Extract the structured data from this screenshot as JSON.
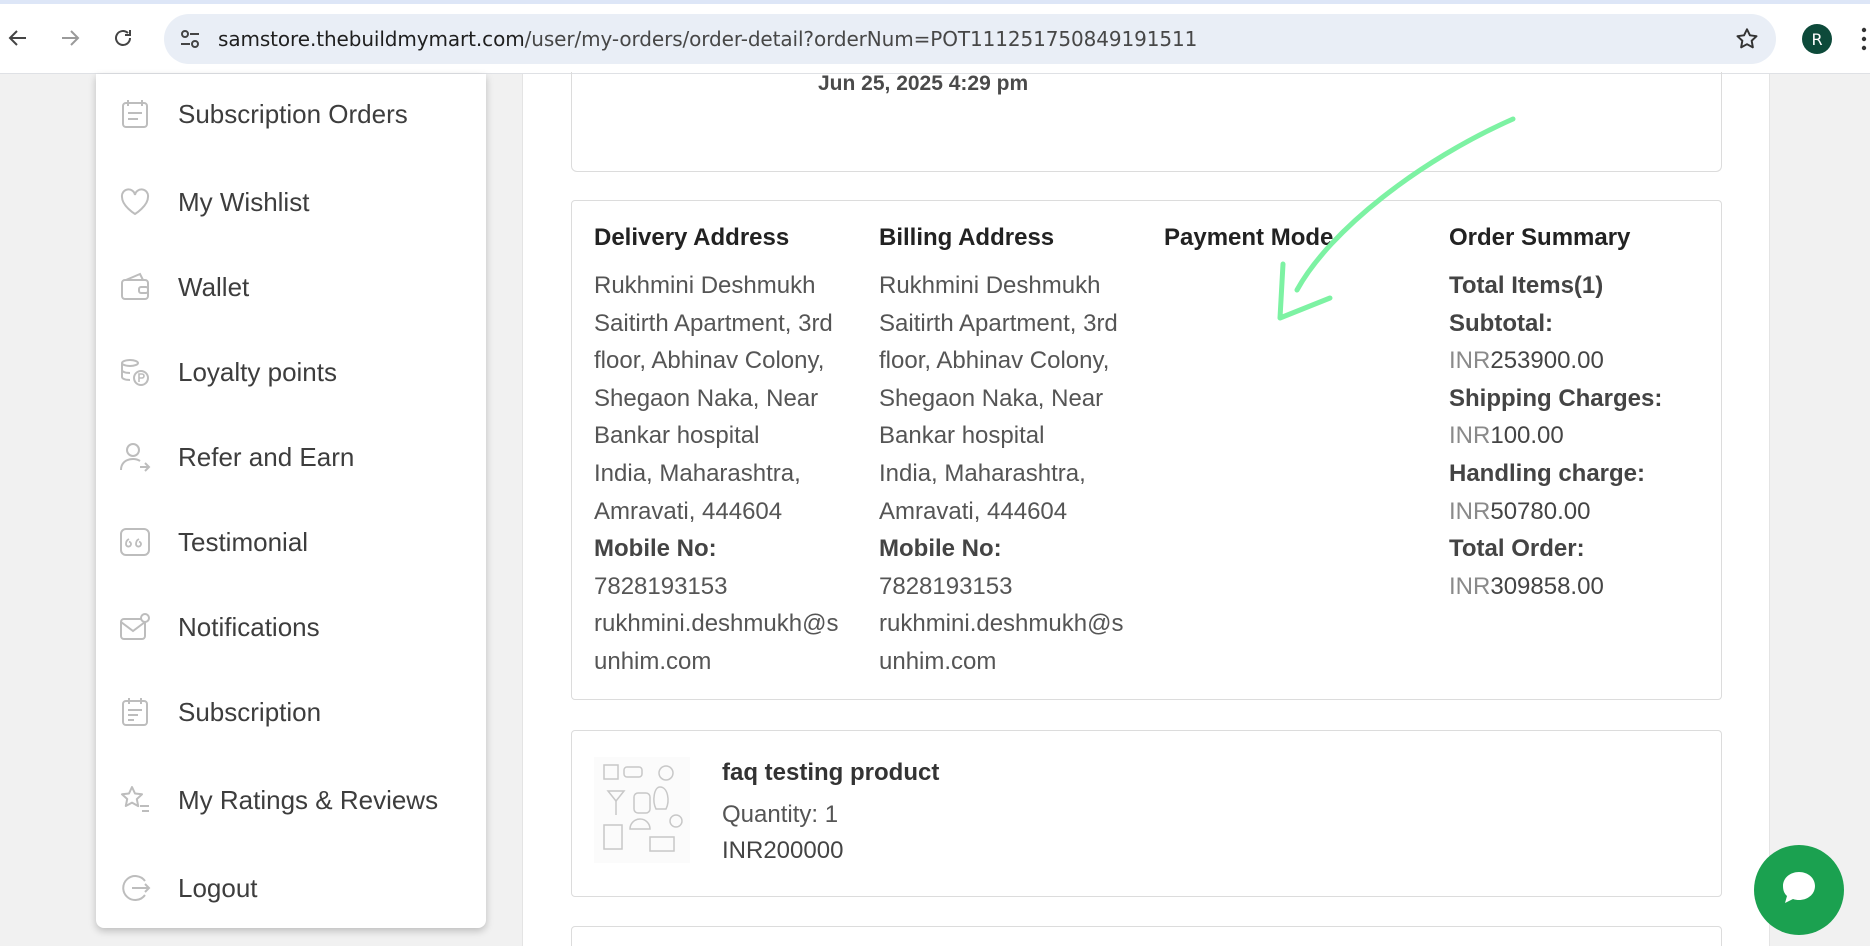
{
  "browser": {
    "url_host": "samstore.thebuildmymart.com",
    "url_path": "/user/my-orders/order-detail?orderNum=POT111251750849191511",
    "profile_initial": "R"
  },
  "sidebar": {
    "items": [
      {
        "label": "Subscription Orders",
        "icon": "calendar-list-icon"
      },
      {
        "label": "My Wishlist",
        "icon": "heart-icon"
      },
      {
        "label": "Wallet",
        "icon": "wallet-icon"
      },
      {
        "label": "Loyalty points",
        "icon": "coins-icon"
      },
      {
        "label": "Refer and Earn",
        "icon": "user-share-icon"
      },
      {
        "label": "Testimonial",
        "icon": "quote-icon"
      },
      {
        "label": "Notifications",
        "icon": "mail-bell-icon"
      },
      {
        "label": "Subscription",
        "icon": "subscription-doc-icon"
      },
      {
        "label": "My Ratings & Reviews",
        "icon": "star-list-icon"
      },
      {
        "label": "Logout",
        "icon": "logout-icon"
      }
    ]
  },
  "order": {
    "date": "Jun 25, 2025 4:29 pm",
    "delivery": {
      "title": "Delivery Address",
      "lines": [
        "Rukhmini Deshmukh",
        "Saitirth Apartment, 3rd",
        "floor, Abhinav Colony,",
        "Shegaon Naka, Near",
        "Bankar hospital",
        "India, Maharashtra,",
        "Amravati, 444604"
      ],
      "mobile_label": "Mobile No:",
      "mobile": "7828193153",
      "email_lines": [
        "rukhmini.deshmukh@s",
        "unhim.com"
      ]
    },
    "billing": {
      "title": "Billing Address",
      "lines": [
        "Rukhmini Deshmukh",
        "Saitirth Apartment, 3rd",
        "floor, Abhinav Colony,",
        "Shegaon Naka, Near",
        "Bankar hospital",
        "India, Maharashtra,",
        "Amravati, 444604"
      ],
      "mobile_label": "Mobile No:",
      "mobile": "7828193153",
      "email_lines": [
        "rukhmini.deshmukh@s",
        "unhim.com"
      ]
    },
    "payment": {
      "title": "Payment Mode"
    },
    "summary": {
      "title": "Order Summary",
      "total_items": "Total Items(1)",
      "subtotal_label": "Subtotal:",
      "subtotal_currency": "INR",
      "subtotal_value": "253900.00",
      "shipping_label": "Shipping Charges:",
      "shipping_currency": "INR",
      "shipping_value": "100.00",
      "handling_label": "Handling charge:",
      "handling_currency": "INR",
      "handling_value": "50780.00",
      "total_label": "Total Order:",
      "total_currency": "INR",
      "total_value": "309858.00"
    },
    "product": {
      "name": "faq testing product",
      "quantity": "Quantity: 1",
      "price": "INR200000"
    }
  },
  "colors": {
    "annotation_arrow": "#7df2a3",
    "chat_button": "#1ba150",
    "avatar": "#0d4a3a"
  }
}
